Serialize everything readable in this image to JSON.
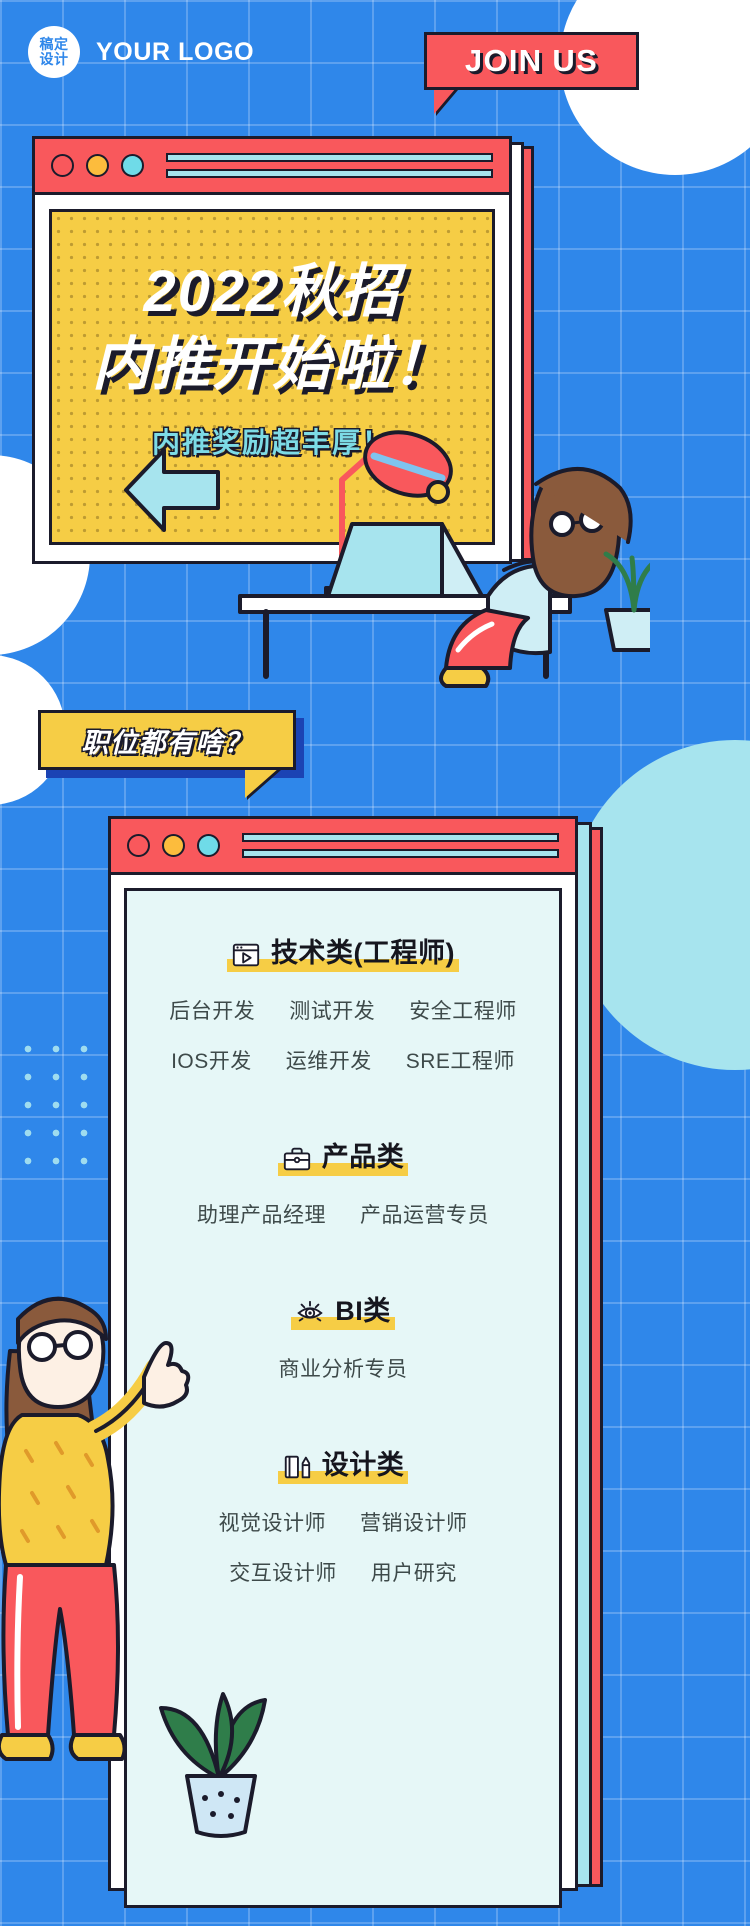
{
  "header": {
    "logo_badge_line1": "稿定",
    "logo_badge_line2": "设计",
    "logo_text": "YOUR LOGO",
    "join_us": "JOIN US"
  },
  "hero": {
    "headline_line1": "2022秋招",
    "headline_line2": "内推开始啦！",
    "subtitle": "内推奖励超丰厚！"
  },
  "section_tag": {
    "label": "职位都有啥？"
  },
  "job_categories": [
    {
      "icon": "browser-play-icon",
      "title": "技术类(工程师)",
      "rows": [
        [
          "后台开发",
          "测试开发",
          "安全工程师"
        ],
        [
          "IOS开发",
          "运维开发",
          "SRE工程师"
        ]
      ]
    },
    {
      "icon": "briefcase-icon",
      "title": "产品类",
      "rows": [
        [
          "助理产品经理",
          "产品运营专员"
        ]
      ]
    },
    {
      "icon": "eye-icon",
      "title": "BI类",
      "rows": [
        [
          "商业分析专员"
        ]
      ]
    },
    {
      "icon": "book-pencil-icon",
      "title": "设计类",
      "rows": [
        [
          "视觉设计师",
          "营销设计师"
        ],
        [
          "交互设计师",
          "用户研究"
        ]
      ]
    }
  ],
  "colors": {
    "background_blue": "#2f87ea",
    "accent_red": "#f9585c",
    "accent_yellow": "#f6cd45",
    "accent_cyan": "#a7e4ee",
    "outline_dark": "#1b1b2b",
    "panel_mint": "#e6f7f7"
  }
}
